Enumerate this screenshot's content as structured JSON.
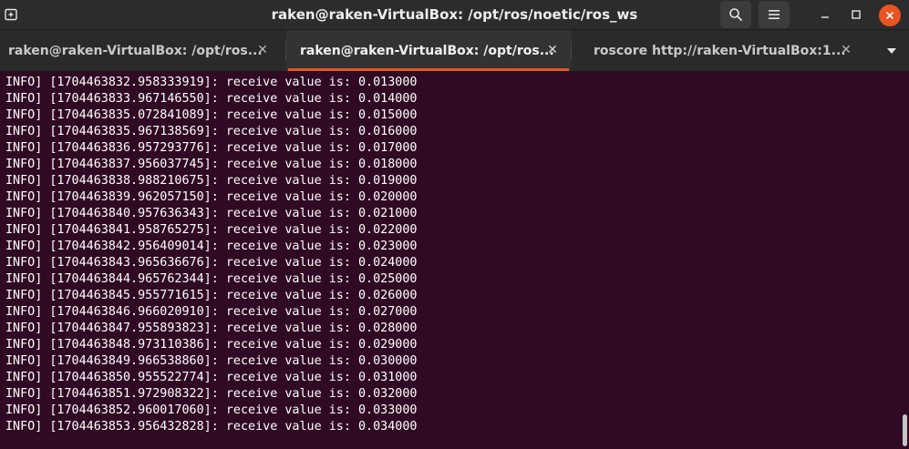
{
  "window": {
    "title": "raken@raken-VirtualBox: /opt/ros/noetic/ros_ws"
  },
  "titlebar": {
    "new_tab_icon": "new-tab-icon",
    "search_icon": "search-icon",
    "menu_icon": "hamburger-menu-icon",
    "minimize_icon": "minimize-icon",
    "maximize_icon": "maximize-icon",
    "close_icon": "close-icon",
    "close_color": "#e95420"
  },
  "tabs": [
    {
      "label": "raken@raken-VirtualBox: /opt/ros...",
      "active": false
    },
    {
      "label": "raken@raken-VirtualBox: /opt/ros...",
      "active": true
    },
    {
      "label": "roscore http://raken-VirtualBox:1...",
      "active": false
    }
  ],
  "colors": {
    "terminal_background": "#300a24",
    "accent": "#e95420",
    "text": "#ffffff"
  },
  "log": [
    "INFO] [1704463832.958333919]: receive value is: 0.013000",
    "INFO] [1704463833.967146550]: receive value is: 0.014000",
    "INFO] [1704463835.072841089]: receive value is: 0.015000",
    "INFO] [1704463835.967138569]: receive value is: 0.016000",
    "INFO] [1704463836.957293776]: receive value is: 0.017000",
    "INFO] [1704463837.956037745]: receive value is: 0.018000",
    "INFO] [1704463838.988210675]: receive value is: 0.019000",
    "INFO] [1704463839.962057150]: receive value is: 0.020000",
    "INFO] [1704463840.957636343]: receive value is: 0.021000",
    "INFO] [1704463841.958765275]: receive value is: 0.022000",
    "INFO] [1704463842.956409014]: receive value is: 0.023000",
    "INFO] [1704463843.965636676]: receive value is: 0.024000",
    "INFO] [1704463844.965762344]: receive value is: 0.025000",
    "INFO] [1704463845.955771615]: receive value is: 0.026000",
    "INFO] [1704463846.966020910]: receive value is: 0.027000",
    "INFO] [1704463847.955893823]: receive value is: 0.028000",
    "INFO] [1704463848.973110386]: receive value is: 0.029000",
    "INFO] [1704463849.966538860]: receive value is: 0.030000",
    "INFO] [1704463850.955522774]: receive value is: 0.031000",
    "INFO] [1704463851.972908322]: receive value is: 0.032000",
    "INFO] [1704463852.960017060]: receive value is: 0.033000",
    "INFO] [1704463853.956432828]: receive value is: 0.034000"
  ]
}
